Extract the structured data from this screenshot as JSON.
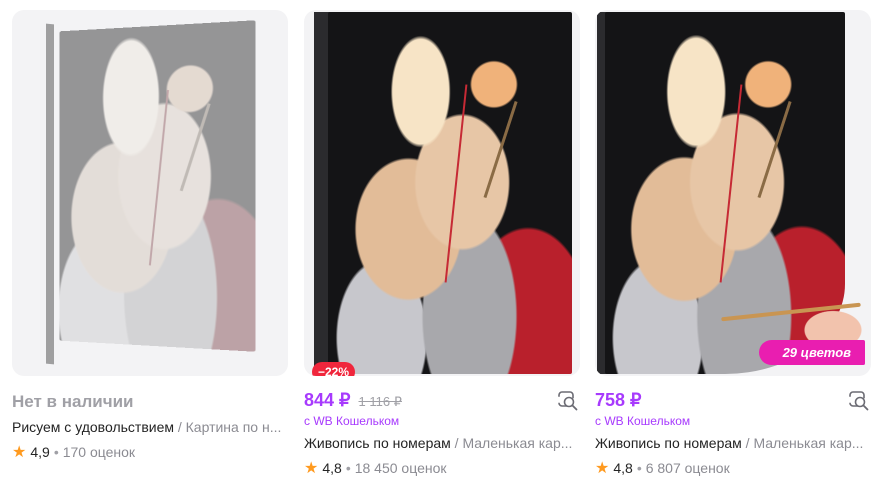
{
  "colors": {
    "accent": "#a73afd",
    "discount": "#f0263c",
    "ribbon": "#e91eb0",
    "star": "#ff9a1f"
  },
  "products": [
    {
      "status": "Нет в наличии",
      "brand": "Рисуем с удовольствием",
      "category": "/ Картина по н...",
      "rating": "4,9",
      "separator": "•",
      "reviews": "170 оценок"
    },
    {
      "price": "844 ₽",
      "old_price": "1 116 ₽",
      "discount": "−22%",
      "wallet": "с WB Кошельком",
      "brand": "Живопись по номерам",
      "category": "/ Маленькая кар...",
      "rating": "4,8",
      "separator": "•",
      "reviews": "18 450 оценок"
    },
    {
      "price": "758 ₽",
      "wallet": "с WB Кошельком",
      "badge": "29 цветов",
      "brand": "Живопись по номерам",
      "category": "/ Маленькая кар...",
      "rating": "4,8",
      "separator": "•",
      "reviews": "6 807 оценок"
    }
  ],
  "icons": {
    "star": "star-icon",
    "similar": "similar-search-icon"
  }
}
